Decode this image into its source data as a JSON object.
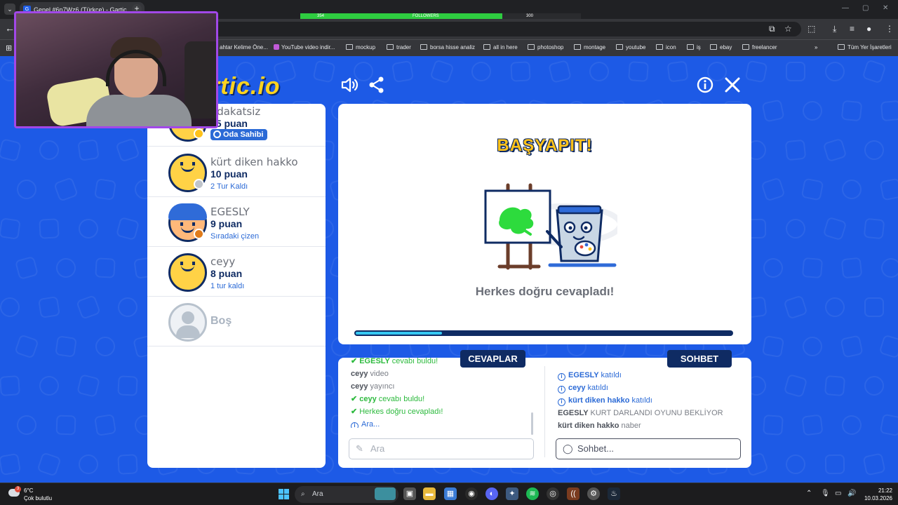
{
  "browser": {
    "tab_title": "Genel #6n7Wz6 (Türkçe) - Gartic",
    "tab_favicon": "G",
    "close_glyph": "✕",
    "newtab_glyph": "+",
    "overlay_left": "354",
    "overlay_mid": "FOLLOWERS",
    "overlay_right": "300",
    "overlay_progress": 0.72,
    "bookmarks": [
      "ahtar Kelime Öne...",
      "YouTube video indir...",
      "mockup",
      "trader",
      "borsa hisse analiz",
      "all in here",
      "photoshop",
      "montage",
      "youtube",
      "icon",
      "iş",
      "ebay",
      "freelancer"
    ],
    "bookmarks_more": "»",
    "all_bookmarks": "Tüm Yer İşaretleri"
  },
  "game": {
    "logo": "rtic.io",
    "players": [
      {
        "name": "adakatsiz",
        "score": "15 puan",
        "badge": "Oda Sahibi",
        "dot_color": "#ffc21a"
      },
      {
        "name": "kürt diken hakko",
        "score": "10 puan",
        "status": "2 Tur Kaldı",
        "dot_color": "#bfc4cb"
      },
      {
        "name": "EGESLY",
        "score": "9 puan",
        "status": "Sıradaki çizen",
        "dot_color": "#e07b1a"
      },
      {
        "name": "ceyy",
        "score": "8 puan",
        "status": "1 tur kaldı"
      }
    ],
    "empty_slot": "Boş",
    "stage": {
      "title": "BAŞYAPIT!",
      "message": "Herkes doğru cevapladı!",
      "timer_progress": 0.23
    },
    "answers": {
      "tab_label": "CEVAPLAR",
      "messages": [
        {
          "type": "green",
          "user": "EGESLY",
          "text": "cevabı buldu!"
        },
        {
          "type": "plain",
          "user": "ceyy",
          "text": "video"
        },
        {
          "type": "plain",
          "user": "ceyy",
          "text": "yayıncı"
        },
        {
          "type": "green",
          "user": "ceyy",
          "text": "cevabı buldu!"
        },
        {
          "type": "green",
          "user": "",
          "text": "Herkes doğru cevapladı!"
        },
        {
          "type": "blue",
          "user": "",
          "text": "Ara..."
        }
      ],
      "input_placeholder": "Ara"
    },
    "chat": {
      "tab_label": "SOHBET",
      "messages": [
        {
          "type": "blue",
          "user": "EGESLY",
          "text": "katıldı"
        },
        {
          "type": "blue",
          "user": "ceyy",
          "text": "katıldı"
        },
        {
          "type": "blue",
          "user": "kürt diken hakko",
          "text": "katıldı"
        },
        {
          "type": "plain",
          "user": "EGESLY",
          "text": "KURT DARLANDI OYUNU BEKLİYOR"
        },
        {
          "type": "plain",
          "user": "kürt diken hakko",
          "text": "naber"
        }
      ],
      "input_placeholder": "Sohbet..."
    }
  },
  "taskbar": {
    "weather_badge": "3",
    "temperature": "6°C",
    "weather": "Çok bulutlu",
    "search": "Ara",
    "time": "21:22",
    "date": "10.03.2026"
  },
  "colors": {
    "game_bg": "#1d5ae6",
    "navy": "#0f2b63",
    "accent_blue": "#2b6ad6",
    "correct_green": "#2dba3e",
    "title_yellow": "#ffc21a",
    "webcam_border": "#a248e8"
  },
  "icons": {
    "sound": "speaker-icon",
    "share": "share-icon",
    "info": "info-icon",
    "close": "close-icon"
  }
}
